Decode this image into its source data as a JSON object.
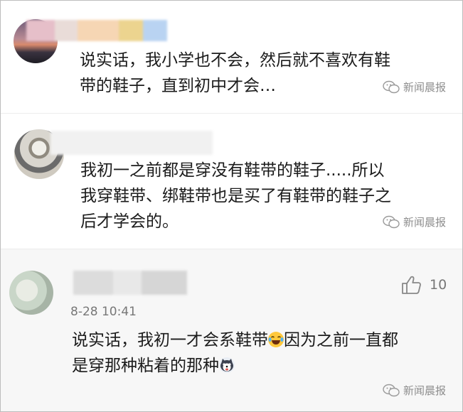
{
  "comments": [
    {
      "text_lines": [
        "说实话，我小学也不会，然后就不喜欢有鞋",
        "带的鞋子，直到初中才会…"
      ],
      "watermark": "新闻晨报"
    },
    {
      "text_lines": [
        "我初一之前都是穿没有鞋带的鞋子.....所以",
        "我穿鞋带、绑鞋带也是买了有鞋带的鞋子之",
        "后才学会的。"
      ],
      "watermark": "新闻晨报"
    },
    {
      "time": "8-28 10:41",
      "likes": "10",
      "text_line1": "说实话，我初一才会系鞋带",
      "text_line1_after": "因为之前一直都",
      "text_line2": "是穿那种粘着的那种",
      "watermark": "新闻晨报"
    }
  ],
  "icons": {
    "like": "thumbs-up-icon",
    "watermark": "wechat-logo-icon",
    "emoji_laugh": "laughing-tears-emoji",
    "emoji_dog": "husky-dog-emoji"
  }
}
